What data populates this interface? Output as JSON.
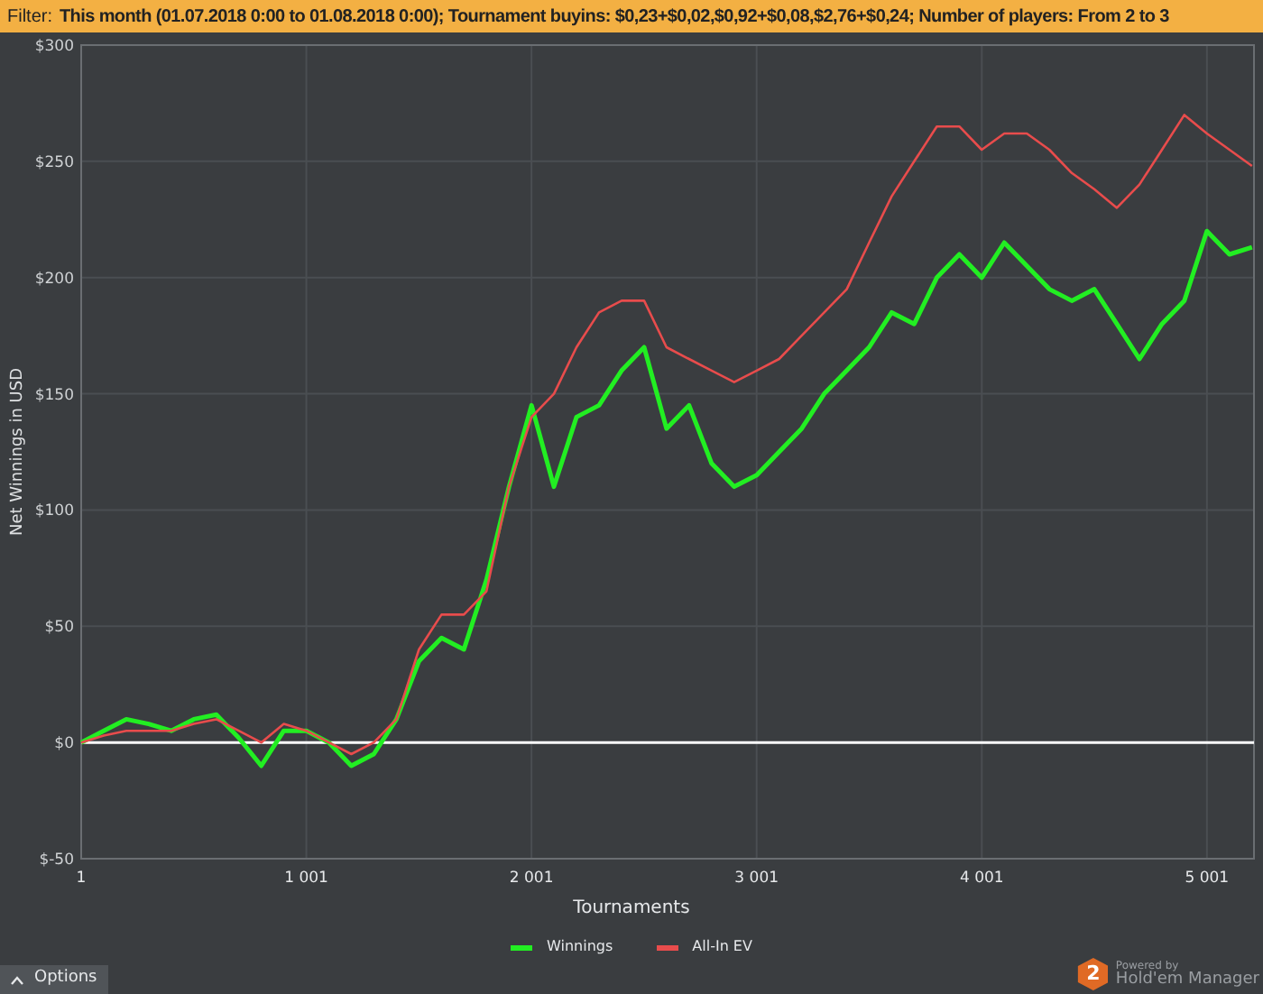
{
  "filter_bar": {
    "label": "Filter:",
    "text": "This month (01.07.2018 0:00 to 01.08.2018 0:00); Tournament buyins: $0,23+$0,02,$0,92+$0,08,$2,76+$0,24; Number of players: From 2 to 3"
  },
  "chart": {
    "chart_data": {
      "type": "line",
      "grid": true,
      "legend": true,
      "xlabel": "Tournaments",
      "ylabel": "Net Winnings in USD",
      "xlim": [
        1,
        5210
      ],
      "ylim": [
        -50,
        300
      ],
      "x": [
        1,
        101,
        201,
        301,
        401,
        501,
        601,
        701,
        801,
        901,
        1001,
        1101,
        1201,
        1301,
        1401,
        1501,
        1601,
        1701,
        1801,
        1901,
        2001,
        2101,
        2201,
        2301,
        2401,
        2501,
        2601,
        2701,
        2801,
        2901,
        3001,
        3101,
        3201,
        3301,
        3401,
        3501,
        3601,
        3701,
        3801,
        3901,
        4001,
        4101,
        4201,
        4301,
        4401,
        4501,
        4601,
        4701,
        4801,
        4901,
        5001,
        5101,
        5201
      ],
      "series": [
        {
          "name": "Winnings",
          "color": "#22ee22",
          "values": [
            0,
            5,
            10,
            8,
            5,
            10,
            12,
            2,
            -10,
            5,
            5,
            0,
            -10,
            -5,
            10,
            35,
            45,
            40,
            70,
            110,
            145,
            110,
            140,
            145,
            160,
            170,
            135,
            145,
            120,
            110,
            115,
            125,
            135,
            150,
            160,
            170,
            185,
            180,
            200,
            210,
            200,
            215,
            205,
            195,
            190,
            195,
            180,
            165,
            180,
            190,
            220,
            210,
            213
          ]
        },
        {
          "name": "All-In EV",
          "color": "#e84c4c",
          "values": [
            0,
            3,
            5,
            5,
            5,
            8,
            10,
            5,
            0,
            8,
            5,
            0,
            -5,
            0,
            10,
            40,
            55,
            55,
            65,
            110,
            140,
            150,
            170,
            185,
            190,
            190,
            170,
            165,
            160,
            155,
            160,
            165,
            175,
            185,
            195,
            215,
            235,
            250,
            265,
            265,
            255,
            262,
            262,
            255,
            245,
            238,
            230,
            240,
            255,
            270,
            262,
            255,
            248
          ]
        }
      ],
      "xticks": [
        {
          "value": 1,
          "label": "1"
        },
        {
          "value": 1001,
          "label": "1 001"
        },
        {
          "value": 2001,
          "label": "2 001"
        },
        {
          "value": 3001,
          "label": "3 001"
        },
        {
          "value": 4001,
          "label": "4 001"
        },
        {
          "value": 5001,
          "label": "5 001"
        }
      ],
      "yticks": [
        {
          "value": -50,
          "label": "$-50"
        },
        {
          "value": 0,
          "label": "$0"
        },
        {
          "value": 50,
          "label": "$50"
        },
        {
          "value": 100,
          "label": "$100"
        },
        {
          "value": 150,
          "label": "$150"
        },
        {
          "value": 200,
          "label": "$200"
        },
        {
          "value": 250,
          "label": "$250"
        },
        {
          "value": 300,
          "label": "$300"
        }
      ]
    }
  },
  "footer": {
    "options_button": "Options",
    "powered_by": "Powered by",
    "brand": "Hold'em Manager",
    "logo_digit": "2"
  }
}
